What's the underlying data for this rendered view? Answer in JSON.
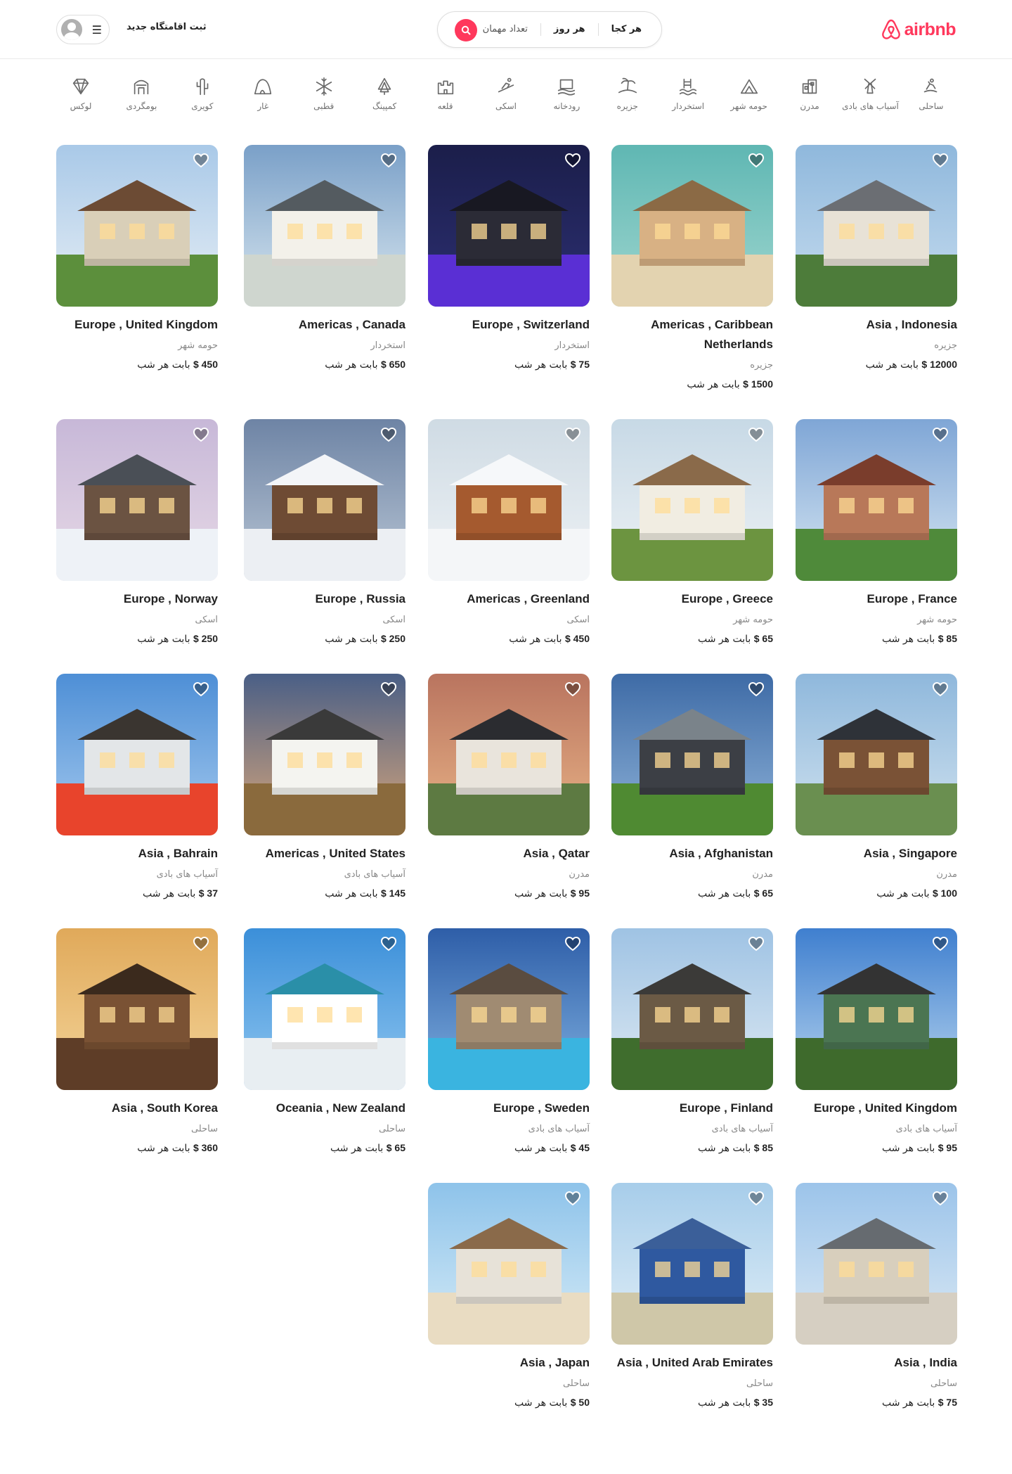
{
  "header": {
    "logo_text": "airbnb",
    "search": {
      "where": "هر کجا",
      "when": "هر روز",
      "guests": "تعداد مهمان"
    },
    "host_link": "ثبت اقامتگاه جدید"
  },
  "categories": [
    {
      "label": "ساحلی",
      "icon": "surfing-icon"
    },
    {
      "label": "آسیاب های بادی",
      "icon": "windmill-icon"
    },
    {
      "label": "مدرن",
      "icon": "modern-building-icon"
    },
    {
      "label": "حومه شهر",
      "icon": "countryside-icon"
    },
    {
      "label": "استخردار",
      "icon": "pool-icon"
    },
    {
      "label": "جزیره",
      "icon": "island-icon"
    },
    {
      "label": "رودخانه",
      "icon": "river-icon"
    },
    {
      "label": "اسکی",
      "icon": "ski-icon"
    },
    {
      "label": "قلعه",
      "icon": "castle-icon"
    },
    {
      "label": "کمپینگ",
      "icon": "camping-icon"
    },
    {
      "label": "قطبی",
      "icon": "snowflake-icon"
    },
    {
      "label": "غار",
      "icon": "cave-icon"
    },
    {
      "label": "کویری",
      "icon": "cactus-icon"
    },
    {
      "label": "بومگردی",
      "icon": "cabin-icon"
    },
    {
      "label": "لوکس",
      "icon": "diamond-icon"
    }
  ],
  "price_suffix": "بابت هر شب",
  "currency": "$",
  "listings": [
    {
      "title": "Asia , Indonesia",
      "category": "جزیره",
      "price": "12000"
    },
    {
      "title": "Americas , Caribbean Netherlands",
      "category": "جزیره",
      "price": "1500"
    },
    {
      "title": "Europe , Switzerland",
      "category": "استخردار",
      "price": "75"
    },
    {
      "title": "Americas , Canada",
      "category": "استخردار",
      "price": "650"
    },
    {
      "title": "Europe , United Kingdom",
      "category": "حومه شهر",
      "price": "450"
    },
    {
      "title": "Europe , France",
      "category": "حومه شهر",
      "price": "85"
    },
    {
      "title": "Europe , Greece",
      "category": "حومه شهر",
      "price": "65"
    },
    {
      "title": "Americas , Greenland",
      "category": "اسکی",
      "price": "450"
    },
    {
      "title": "Europe , Russia",
      "category": "اسکی",
      "price": "250"
    },
    {
      "title": "Europe , Norway",
      "category": "اسکی",
      "price": "250"
    },
    {
      "title": "Asia , Singapore",
      "category": "مدرن",
      "price": "100"
    },
    {
      "title": "Asia , Afghanistan",
      "category": "مدرن",
      "price": "65"
    },
    {
      "title": "Asia , Qatar",
      "category": "مدرن",
      "price": "95"
    },
    {
      "title": "Americas , United States",
      "category": "آسیاب های بادی",
      "price": "145"
    },
    {
      "title": "Asia , Bahrain",
      "category": "آسیاب های بادی",
      "price": "37"
    },
    {
      "title": "Europe , United Kingdom",
      "category": "آسیاب های بادی",
      "price": "95"
    },
    {
      "title": "Europe , Finland",
      "category": "آسیاب های بادی",
      "price": "85"
    },
    {
      "title": "Europe , Sweden",
      "category": "آسیاب های بادی",
      "price": "45"
    },
    {
      "title": "Oceania , New Zealand",
      "category": "ساحلی",
      "price": "65"
    },
    {
      "title": "Asia , South Korea",
      "category": "ساحلی",
      "price": "360"
    },
    {
      "title": "Asia , India",
      "category": "ساحلی",
      "price": "75"
    },
    {
      "title": "Asia , United Arab Emirates",
      "category": "ساحلی",
      "price": "35"
    },
    {
      "title": "Asia , Japan",
      "category": "ساحلی",
      "price": "50"
    }
  ],
  "colors": {
    "brand": "#ff385c",
    "text": "#222222",
    "muted": "#888888"
  }
}
